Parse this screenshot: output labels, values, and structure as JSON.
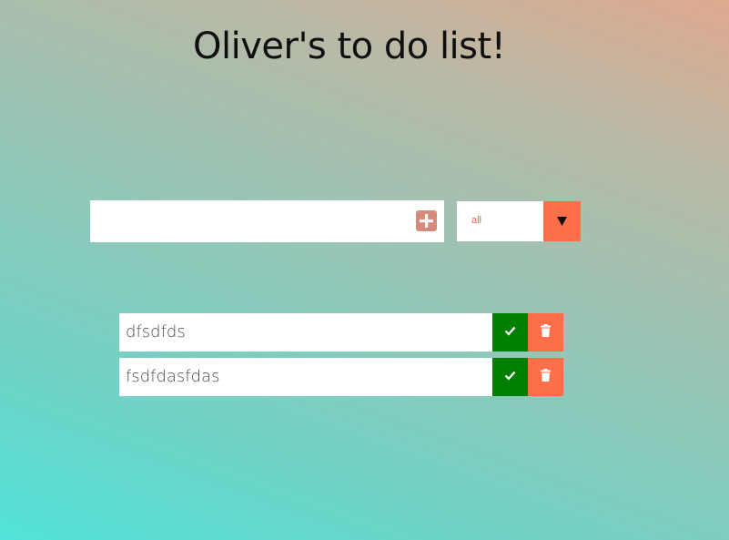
{
  "header": {
    "title": "Oliver's to do list!"
  },
  "form": {
    "input_value": "",
    "input_placeholder": "",
    "add_icon": "plus-square-icon",
    "add_icon_color": "#d58a7c"
  },
  "filter": {
    "selected": "all",
    "arrow_icon": "triangle-down-icon",
    "accent_color": "#fd6f48"
  },
  "todos": [
    {
      "text": "dfsdfds"
    },
    {
      "text": "fsdfdasfdas"
    }
  ],
  "actions": {
    "complete_icon": "check-icon",
    "complete_color": "#018000",
    "delete_icon": "trash-icon",
    "delete_color": "#fd6f48"
  }
}
